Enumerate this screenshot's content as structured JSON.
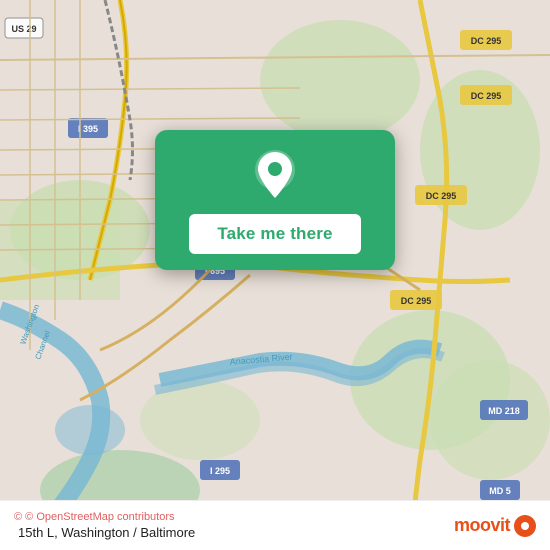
{
  "map": {
    "attribution": "© OpenStreetMap contributors",
    "location_label": "15th L, Washington / Baltimore",
    "background_color": "#e8e0d8"
  },
  "popup": {
    "button_label": "Take me there",
    "bg_color": "#2eaa6e"
  },
  "moovit": {
    "logo_text": "moovit",
    "logo_color": "#e8501a"
  }
}
